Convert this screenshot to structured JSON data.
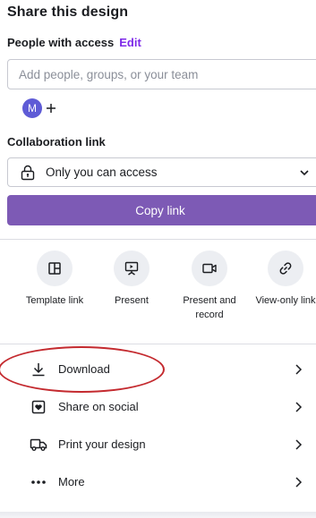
{
  "title": "Share this design",
  "people": {
    "label": "People with access",
    "edit_label": "Edit"
  },
  "add_input": {
    "placeholder": "Add people, groups, or your team",
    "value": ""
  },
  "avatar": {
    "initial": "M",
    "add_label": "+"
  },
  "collab": {
    "label": "Collaboration link",
    "selected": "Only you can access"
  },
  "copy_button": "Copy link",
  "quick_actions": [
    {
      "icon": "template-icon",
      "label": "Template link"
    },
    {
      "icon": "present-icon",
      "label": "Present"
    },
    {
      "icon": "present-record-icon",
      "label_line1": "Present and",
      "label_line2": "record"
    },
    {
      "icon": "link-icon",
      "label": "View-only link"
    }
  ],
  "actions": [
    {
      "icon": "download-icon",
      "label": "Download"
    },
    {
      "icon": "heart-icon",
      "label": "Share on social"
    },
    {
      "icon": "truck-icon",
      "label": "Print your design"
    },
    {
      "icon": "more-icon",
      "label": "More"
    }
  ],
  "colors": {
    "accent": "#7d2ae8",
    "copy_button": "#7d5ab5",
    "avatar": "#5e5bd6",
    "annotation_circle": "#c42a2f"
  }
}
